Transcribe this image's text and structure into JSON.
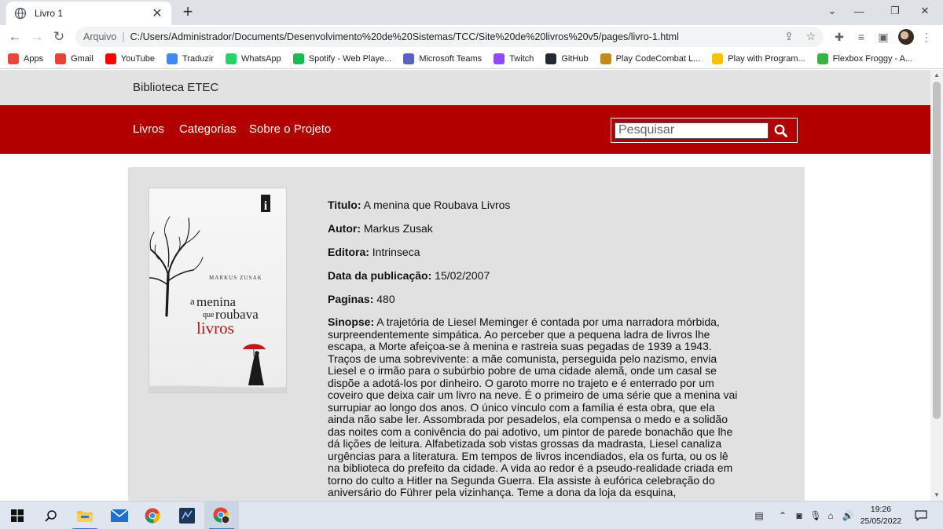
{
  "browser": {
    "tab_title": "Livro 1",
    "new_tab": "+",
    "address": {
      "protocol_label": "Arquivo",
      "separator": "|",
      "url": "C:/Users/Administrador/Documents/Desenvolvimento%20de%20Sistemas/TCC/Site%20de%20livros%20v5/pages/livro-1.html"
    },
    "bookmarks": [
      {
        "label": "Apps",
        "icon": "apps-grid-icon",
        "color": "#e8453c"
      },
      {
        "label": "Gmail",
        "icon": "gmail-icon",
        "color": "#ea4335"
      },
      {
        "label": "YouTube",
        "icon": "youtube-icon",
        "color": "#ff0000"
      },
      {
        "label": "Traduzir",
        "icon": "google-translate-icon",
        "color": "#4285f4"
      },
      {
        "label": "WhatsApp",
        "icon": "whatsapp-icon",
        "color": "#25d366"
      },
      {
        "label": "Spotify - Web Playe...",
        "icon": "spotify-icon",
        "color": "#1db954"
      },
      {
        "label": "Microsoft Teams",
        "icon": "teams-icon",
        "color": "#5b5fc7"
      },
      {
        "label": "Twitch",
        "icon": "twitch-icon",
        "color": "#9146ff"
      },
      {
        "label": "GitHub",
        "icon": "github-icon",
        "color": "#24292f"
      },
      {
        "label": "Play CodeCombat L...",
        "icon": "codecombat-icon",
        "color": "#c28a19"
      },
      {
        "label": "Play with Program...",
        "icon": "program-icon",
        "color": "#f5c400"
      },
      {
        "label": "Flexbox Froggy - A...",
        "icon": "froggy-icon",
        "color": "#3bb143"
      }
    ]
  },
  "site": {
    "name": "Biblioteca ETEC",
    "nav": [
      "Livros",
      "Categorias",
      "Sobre o Projeto"
    ],
    "search_placeholder": "Pesquisar",
    "brand_color": "#b20000"
  },
  "book": {
    "cover": {
      "publisher_mark": "i",
      "author": "MARKUS ZUSAK",
      "title_a": "a",
      "title_line1": "menina",
      "title_que": "que",
      "title_line2": "roubava",
      "title_line3": "livros"
    },
    "fields": [
      {
        "label": "Titulo:",
        "value": "A menina que Roubava Livros"
      },
      {
        "label": "Autor:",
        "value": "Markus Zusak"
      },
      {
        "label": "Editora:",
        "value": "Intrinseca"
      },
      {
        "label": "Data da publicação:",
        "value": "15/02/2007"
      },
      {
        "label": "Paginas:",
        "value": "480"
      }
    ],
    "synopsis_label": "Sinopse:",
    "synopsis_lines": [
      "A trajetória de Liesel Meminger é contada por uma narradora mórbida,",
      "surpreendentemente simpática. Ao perceber que a pequena ladra de livros lhe",
      "escapa, a Morte afeiçoa-se à menina e rastreia suas pegadas de 1939 a 1943.",
      "Traços de uma sobrevivente: a mãe comunista, perseguida pelo nazismo, envia",
      "Liesel e o irmão para o subúrbio pobre de uma cidade alemã, onde um casal se",
      "dispõe a adotá-los por dinheiro. O garoto morre no trajeto e é enterrado por um",
      "coveiro que deixa cair um livro na neve. É o primeiro de uma série que a menina vai",
      "surrupiar ao longo dos anos. O único vínculo com a família é esta obra, que ela",
      "ainda não sabe ler. Assombrada por pesadelos, ela compensa o medo e a solidão",
      "das noites com a conivência do pai adotivo, um pintor de parede bonachão que lhe",
      "dá lições de leitura. Alfabetizada sob vistas grossas da madrasta, Liesel canaliza",
      "urgências para a literatura. Em tempos de livros incendiados, ela os furta, ou os lê",
      "na biblioteca do prefeito da cidade. A vida ao redor é a pseudo-realidade criada em",
      "torno do culto a Hitler na Segunda Guerra. Ela assiste à eufórica celebração do",
      "aniversário do Führer pela vizinhança. Teme a dona da loja da esquina,"
    ]
  },
  "taskbar": {
    "time": "19:26",
    "date": "25/05/2022"
  }
}
